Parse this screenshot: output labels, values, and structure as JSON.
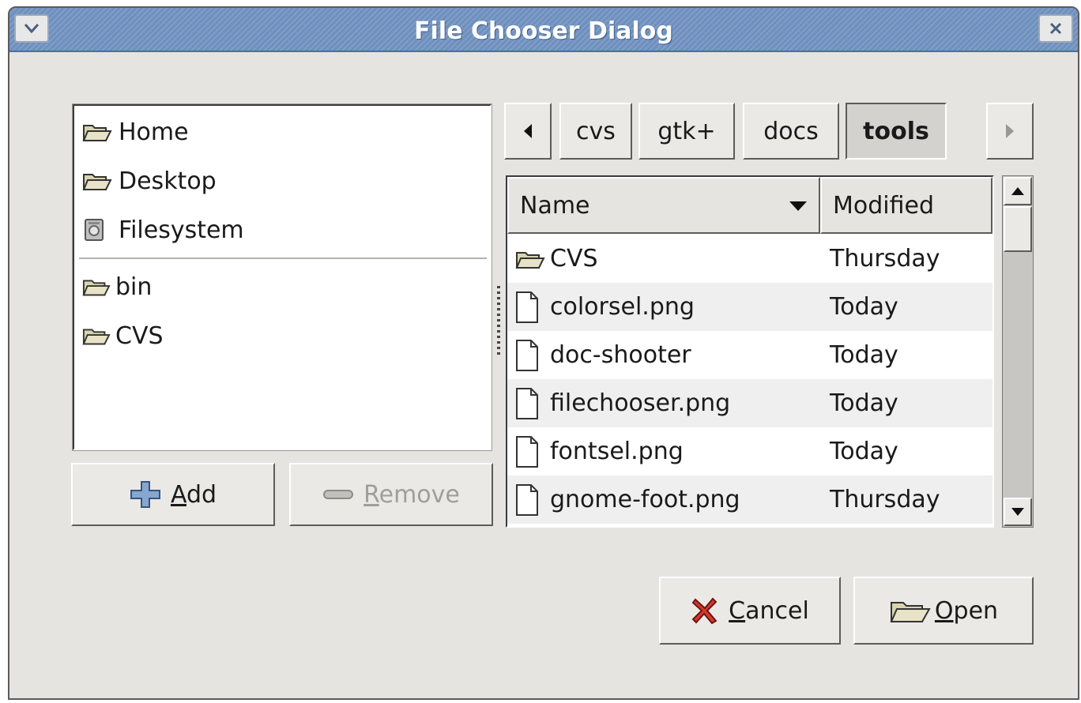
{
  "window": {
    "title": "File Chooser Dialog"
  },
  "places": {
    "items": [
      {
        "label": "Home",
        "icon": "folder-icon"
      },
      {
        "label": "Desktop",
        "icon": "folder-icon"
      },
      {
        "label": "Filesystem",
        "icon": "drive-icon"
      }
    ],
    "bookmarks": [
      {
        "label": "bin",
        "icon": "folder-icon"
      },
      {
        "label": "CVS",
        "icon": "folder-icon"
      }
    ],
    "add_label": "Add",
    "add_mnemonic": "A",
    "add_rest": "dd",
    "remove_label": "Remove",
    "remove_mnemonic": "R",
    "remove_rest": "emove"
  },
  "pathbar": {
    "segments": [
      "cvs",
      "gtk+",
      "docs",
      "tools"
    ],
    "active": "tools"
  },
  "file_list": {
    "columns": {
      "name": "Name",
      "modified": "Modified"
    },
    "sort": "descending",
    "rows": [
      {
        "name": "CVS",
        "modified": "Thursday",
        "icon": "folder-icon"
      },
      {
        "name": "colorsel.png",
        "modified": "Today",
        "icon": "file-icon"
      },
      {
        "name": "doc-shooter",
        "modified": "Today",
        "icon": "file-icon"
      },
      {
        "name": "filechooser.png",
        "modified": "Today",
        "icon": "file-icon"
      },
      {
        "name": "fontsel.png",
        "modified": "Today",
        "icon": "file-icon"
      },
      {
        "name": "gnome-foot.png",
        "modified": "Thursday",
        "icon": "file-icon"
      }
    ]
  },
  "actions": {
    "cancel_mnemonic": "C",
    "cancel_rest": "ancel",
    "open_mnemonic": "O",
    "open_rest": "pen"
  }
}
